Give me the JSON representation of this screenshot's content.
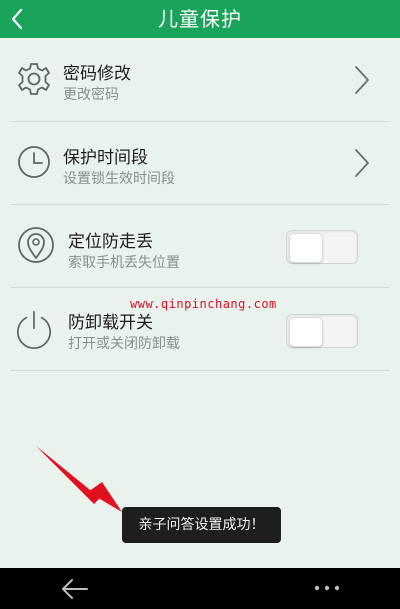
{
  "header": {
    "title": "儿童保护",
    "back_icon": "chevron-left-icon"
  },
  "settings": [
    {
      "title": "密码修改",
      "subtitle": "更改密码",
      "icon": "gear-icon",
      "control": "chevron"
    },
    {
      "title": "保护时间段",
      "subtitle": "设置锁生效时间段",
      "icon": "clock-icon",
      "control": "chevron"
    },
    {
      "title": "定位防走丢",
      "subtitle": "索取手机丢失位置",
      "icon": "location-pin-icon",
      "control": "toggle",
      "enabled": false
    },
    {
      "title": "防卸载开关",
      "subtitle": "打开或关闭防卸载",
      "icon": "power-icon",
      "control": "toggle",
      "enabled": false
    }
  ],
  "watermark": "www.qinpinchang.com",
  "toast": "亲子问答设置成功！",
  "annotation": {
    "arrow_color": "#e0101f"
  },
  "navbar": {
    "back_icon": "back-arrow-icon",
    "more_icon": "more-dots-icon"
  },
  "colors": {
    "accent": "#1aa35a",
    "background": "#eaf2ee"
  }
}
